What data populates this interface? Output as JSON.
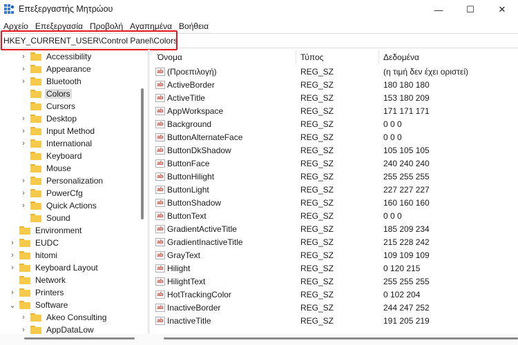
{
  "window": {
    "title": "Επεξεργαστής Μητρώου",
    "min_glyph": "—",
    "max_glyph": "☐",
    "close_glyph": "✕"
  },
  "menu": [
    "Αρχείο",
    "Επεξεργασία",
    "Προβολή",
    "Αγαπημένα",
    "Βοήθεια"
  ],
  "address": {
    "path": "HKEY_CURRENT_USER\\Control Panel\\Colors"
  },
  "tree": [
    {
      "label": "Accessibility",
      "level": 2,
      "expandable": true,
      "selected": false
    },
    {
      "label": "Appearance",
      "level": 2,
      "expandable": true,
      "selected": false
    },
    {
      "label": "Bluetooth",
      "level": 2,
      "expandable": true,
      "selected": false
    },
    {
      "label": "Colors",
      "level": 2,
      "expandable": false,
      "selected": true
    },
    {
      "label": "Cursors",
      "level": 2,
      "expandable": false,
      "selected": false
    },
    {
      "label": "Desktop",
      "level": 2,
      "expandable": true,
      "selected": false
    },
    {
      "label": "Input Method",
      "level": 2,
      "expandable": true,
      "selected": false
    },
    {
      "label": "International",
      "level": 2,
      "expandable": true,
      "selected": false
    },
    {
      "label": "Keyboard",
      "level": 2,
      "expandable": false,
      "selected": false
    },
    {
      "label": "Mouse",
      "level": 2,
      "expandable": false,
      "selected": false
    },
    {
      "label": "Personalization",
      "level": 2,
      "expandable": true,
      "selected": false
    },
    {
      "label": "PowerCfg",
      "level": 2,
      "expandable": true,
      "selected": false
    },
    {
      "label": "Quick Actions",
      "level": 2,
      "expandable": true,
      "selected": false
    },
    {
      "label": "Sound",
      "level": 2,
      "expandable": false,
      "selected": false
    },
    {
      "label": "Environment",
      "level": 1,
      "expandable": false,
      "selected": false
    },
    {
      "label": "EUDC",
      "level": 1,
      "expandable": true,
      "selected": false
    },
    {
      "label": "hitomi",
      "level": 1,
      "expandable": true,
      "selected": false
    },
    {
      "label": "Keyboard Layout",
      "level": 1,
      "expandable": true,
      "selected": false
    },
    {
      "label": "Network",
      "level": 1,
      "expandable": false,
      "selected": false
    },
    {
      "label": "Printers",
      "level": 1,
      "expandable": true,
      "selected": false
    },
    {
      "label": "Software",
      "level": 1,
      "expandable": true,
      "expanded": true,
      "selected": false
    },
    {
      "label": "Akeo Consulting",
      "level": 2,
      "expandable": true,
      "selected": false
    },
    {
      "label": "AppDataLow",
      "level": 2,
      "expandable": true,
      "selected": false
    }
  ],
  "columns": {
    "name": "Όνομα",
    "type": "Τύπος",
    "data": "Δεδομένα"
  },
  "values": [
    {
      "name": "(Προεπιλογή)",
      "type": "REG_SZ",
      "data": "(η τιμή δεν έχει οριστεί)"
    },
    {
      "name": "ActiveBorder",
      "type": "REG_SZ",
      "data": "180 180 180"
    },
    {
      "name": "ActiveTitle",
      "type": "REG_SZ",
      "data": "153 180 209"
    },
    {
      "name": "AppWorkspace",
      "type": "REG_SZ",
      "data": "171 171 171"
    },
    {
      "name": "Background",
      "type": "REG_SZ",
      "data": "0 0 0"
    },
    {
      "name": "ButtonAlternateFace",
      "type": "REG_SZ",
      "data": "0 0 0"
    },
    {
      "name": "ButtonDkShadow",
      "type": "REG_SZ",
      "data": "105 105 105"
    },
    {
      "name": "ButtonFace",
      "type": "REG_SZ",
      "data": "240 240 240"
    },
    {
      "name": "ButtonHilight",
      "type": "REG_SZ",
      "data": "255 255 255"
    },
    {
      "name": "ButtonLight",
      "type": "REG_SZ",
      "data": "227 227 227"
    },
    {
      "name": "ButtonShadow",
      "type": "REG_SZ",
      "data": "160 160 160"
    },
    {
      "name": "ButtonText",
      "type": "REG_SZ",
      "data": "0 0 0"
    },
    {
      "name": "GradientActiveTitle",
      "type": "REG_SZ",
      "data": "185 209 234"
    },
    {
      "name": "GradientInactiveTitle",
      "type": "REG_SZ",
      "data": "215 228 242"
    },
    {
      "name": "GrayText",
      "type": "REG_SZ",
      "data": "109 109 109"
    },
    {
      "name": "Hilight",
      "type": "REG_SZ",
      "data": "0 120 215"
    },
    {
      "name": "HilightText",
      "type": "REG_SZ",
      "data": "255 255 255"
    },
    {
      "name": "HotTrackingColor",
      "type": "REG_SZ",
      "data": "0 102 204"
    },
    {
      "name": "InactiveBorder",
      "type": "REG_SZ",
      "data": "244 247 252"
    },
    {
      "name": "InactiveTitle",
      "type": "REG_SZ",
      "data": "191 205 219"
    }
  ],
  "colors": {
    "highlight_border": "#e5191c",
    "folder": "#f5c94a",
    "selection": "#dcdcdc"
  },
  "icons": {
    "app": "registry-editor-icon",
    "folder": "folder-icon",
    "string_value": "string-value-icon"
  }
}
